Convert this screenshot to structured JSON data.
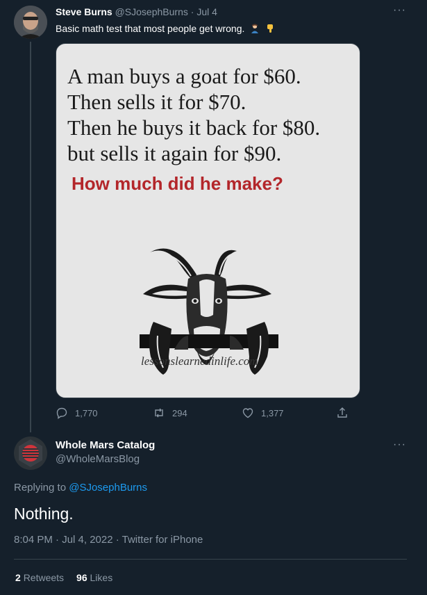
{
  "tweet": {
    "author_name": "Steve Burns",
    "author_handle": "@SJosephBurns",
    "separator": " · ",
    "date": "Jul 4",
    "text": "Basic math test that most people get wrong.",
    "emojis": [
      "person-facepalming-emoji",
      "backhand-index-pointing-down-emoji"
    ],
    "image": {
      "lines": [
        "A man buys a goat for $60.",
        "Then sells it for $70.",
        "Then he buys it back for $80.",
        "but sells it again for $90."
      ],
      "question": "How much did he make?",
      "watermark": "lessonslearnedinlife.com",
      "illustration": "goat-icon",
      "question_color": "#b3262a"
    },
    "actions": {
      "replies": "1,770",
      "retweets": "294",
      "likes": "1,377"
    }
  },
  "reply": {
    "author_name": "Whole Mars Catalog",
    "author_handle": "@WholeMarsBlog",
    "replying_prefix": "Replying to ",
    "replying_to": "@SJosephBurns",
    "text": "Nothing.",
    "timestamp": "8:04 PM · Jul 4, 2022 · Twitter for iPhone",
    "retweets_count": "2",
    "retweets_label": "Retweets",
    "likes_count": "96",
    "likes_label": "Likes"
  },
  "ui": {
    "more_label": "···",
    "accent_color": "#1d9bf0",
    "background_color": "#15202b"
  }
}
